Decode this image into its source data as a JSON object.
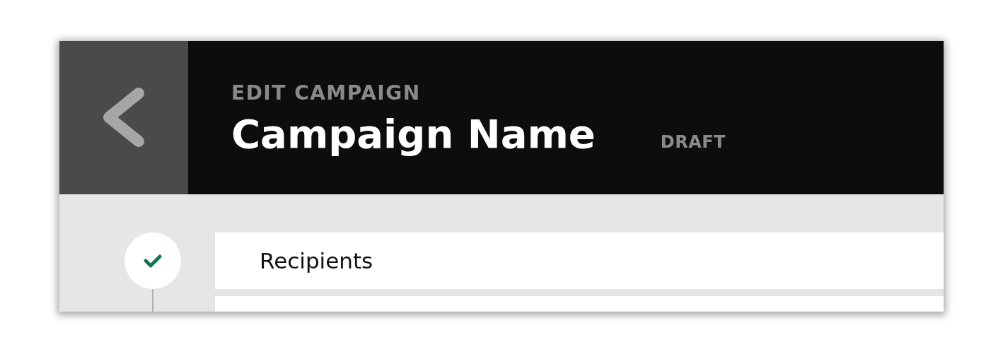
{
  "header": {
    "eyebrow": "EDIT CAMPAIGN",
    "title": "Campaign Name",
    "status": "DRAFT"
  },
  "steps": [
    {
      "label": "Recipients",
      "completed": true
    }
  ]
}
